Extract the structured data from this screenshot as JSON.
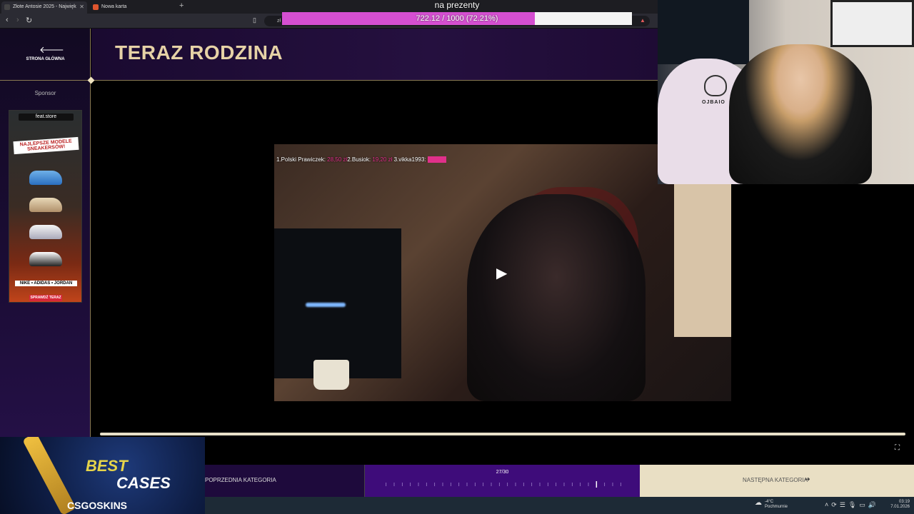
{
  "browser": {
    "tabs": [
      {
        "label": "Złote Antosie 2025 - Najwięk",
        "active": true
      },
      {
        "label": "Nowa karta",
        "active": false
      }
    ],
    "url_fragment": "zł",
    "new_tab_icon": "plus-icon"
  },
  "donation": {
    "title": "na prezenty",
    "current": 722.12,
    "goal": 1000,
    "percent": 72.21,
    "text": "722.12 / 1000 (72.21%)",
    "fill_color": "#d54fd1"
  },
  "sidebar": {
    "home_label": "STRONA GŁÓWNA",
    "sponsor_label": "Sponsor",
    "ad": {
      "store": "feat.store",
      "headline": "NAJLEPSZE MODELE SNEAKERSÓW!",
      "brands": "NIKE • ADIDAS • JORDAN",
      "cta": "SPRAWDŹ TERAZ"
    }
  },
  "header": {
    "title": "TERAZ RODZINA"
  },
  "video": {
    "ranking": [
      {
        "prefix": "1.",
        "name": "Polski Prawiczek:",
        "amount": "28,50 zł"
      },
      {
        "prefix": "2.",
        "name": "Busiok:",
        "amount": "19,20 zł"
      },
      {
        "prefix": "3.",
        "name": "vikka1993:",
        "amount": ""
      }
    ]
  },
  "bottom_nav": {
    "prev_label": "POPRZEDNIA KATEGORIA",
    "counter": "27/30",
    "current": 27,
    "total": 30,
    "next_label": "NASTĘPNA KATEGORIA"
  },
  "webcam": {
    "chair_brand": "OJBAIO"
  },
  "promo": {
    "line1": "BEST",
    "line2": "CASES",
    "brand": "CSGOSKINS"
  },
  "taskbar": {
    "temperature": "-4°C",
    "weather": "Pochmurnie",
    "time": "03:19",
    "date": "7.01.2026"
  },
  "colors": {
    "gold": "#e6d2a6",
    "purple_dark": "#1e0a3c",
    "purple_mid": "#3e0c7a",
    "cream": "#e9dfc4",
    "magenta": "#e0308a"
  }
}
